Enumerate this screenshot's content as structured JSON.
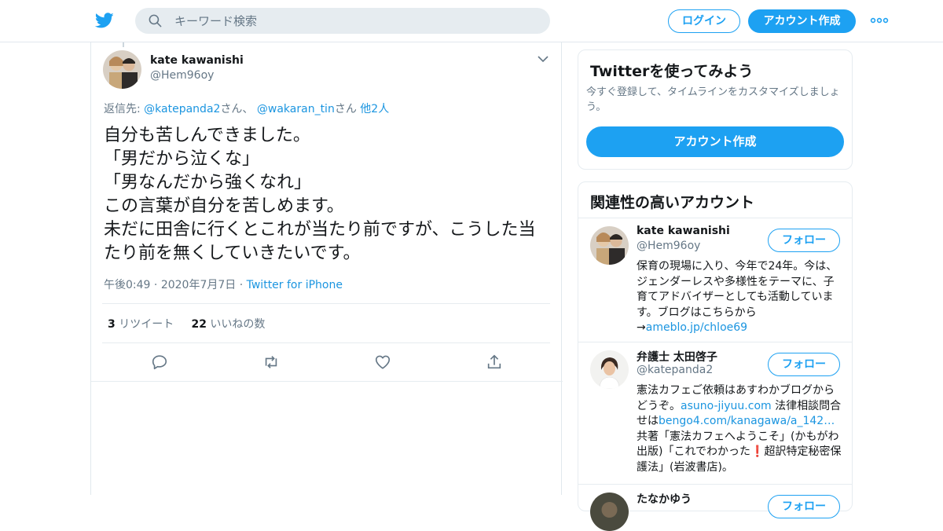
{
  "header": {
    "search_placeholder": "キーワード検索",
    "login_label": "ログイン",
    "signup_label": "アカウント作成"
  },
  "tweet": {
    "author_name": "kate kawanishi",
    "author_handle": "@Hem96oy",
    "reply_prefix": "返信先: ",
    "reply_user1": "@katepanda2",
    "reply_san1": "さん、",
    "reply_user2": "@wakaran_tin",
    "reply_san2": "さん",
    "reply_others": "他2人",
    "text": "自分も苦しんできました。\n「男だから泣くな」\n「男なんだから強くなれ」\nこの言葉が自分を苦しめます。\n未だに田舎に行くとこれが当たり前ですが、こうした当たり前を無くしていきたいです。",
    "time": "午後0:49",
    "date": "2020年7月7日",
    "source": "Twitter for iPhone",
    "retweet_count": "3",
    "retweet_label": "リツイート",
    "like_count": "22",
    "like_label": "いいねの数"
  },
  "signup_card": {
    "title": "Twitterを使ってみよう",
    "description": "今すぐ登録して、タイムラインをカスタマイズしましょう。",
    "button_label": "アカウント作成"
  },
  "related": {
    "title": "関連性の高いアカウント",
    "follow_label": "フォロー",
    "accounts": [
      {
        "name": "kate kawanishi",
        "handle": "@Hem96oy",
        "bio_text": "保育の現場に入り、今年で24年。今は、ジェンダーレスや多様性をテーマに、子育てアドバイザーとしても活動しています。ブログはこちらから→",
        "bio_link": "ameblo.jp/chloe69"
      },
      {
        "name": "弁護士 太田啓子",
        "handle": "@katepanda2",
        "bio_1": "憲法カフェご依頼はあすわかブログからどうぞ。",
        "bio_link1": "asuno-jiyuu.com",
        "bio_2": " 法律相談問合せは",
        "bio_link2": "bengo4.com/kanagawa/a_142…",
        "bio_3": " 共著「憲法カフェへようこそ」(かもがわ出版)「これでわかった",
        "bio_mark": "❗",
        "bio_4": "超訳特定秘密保護法」(岩波書店)。"
      },
      {
        "name": "たなかゆう",
        "handle": ""
      }
    ]
  }
}
